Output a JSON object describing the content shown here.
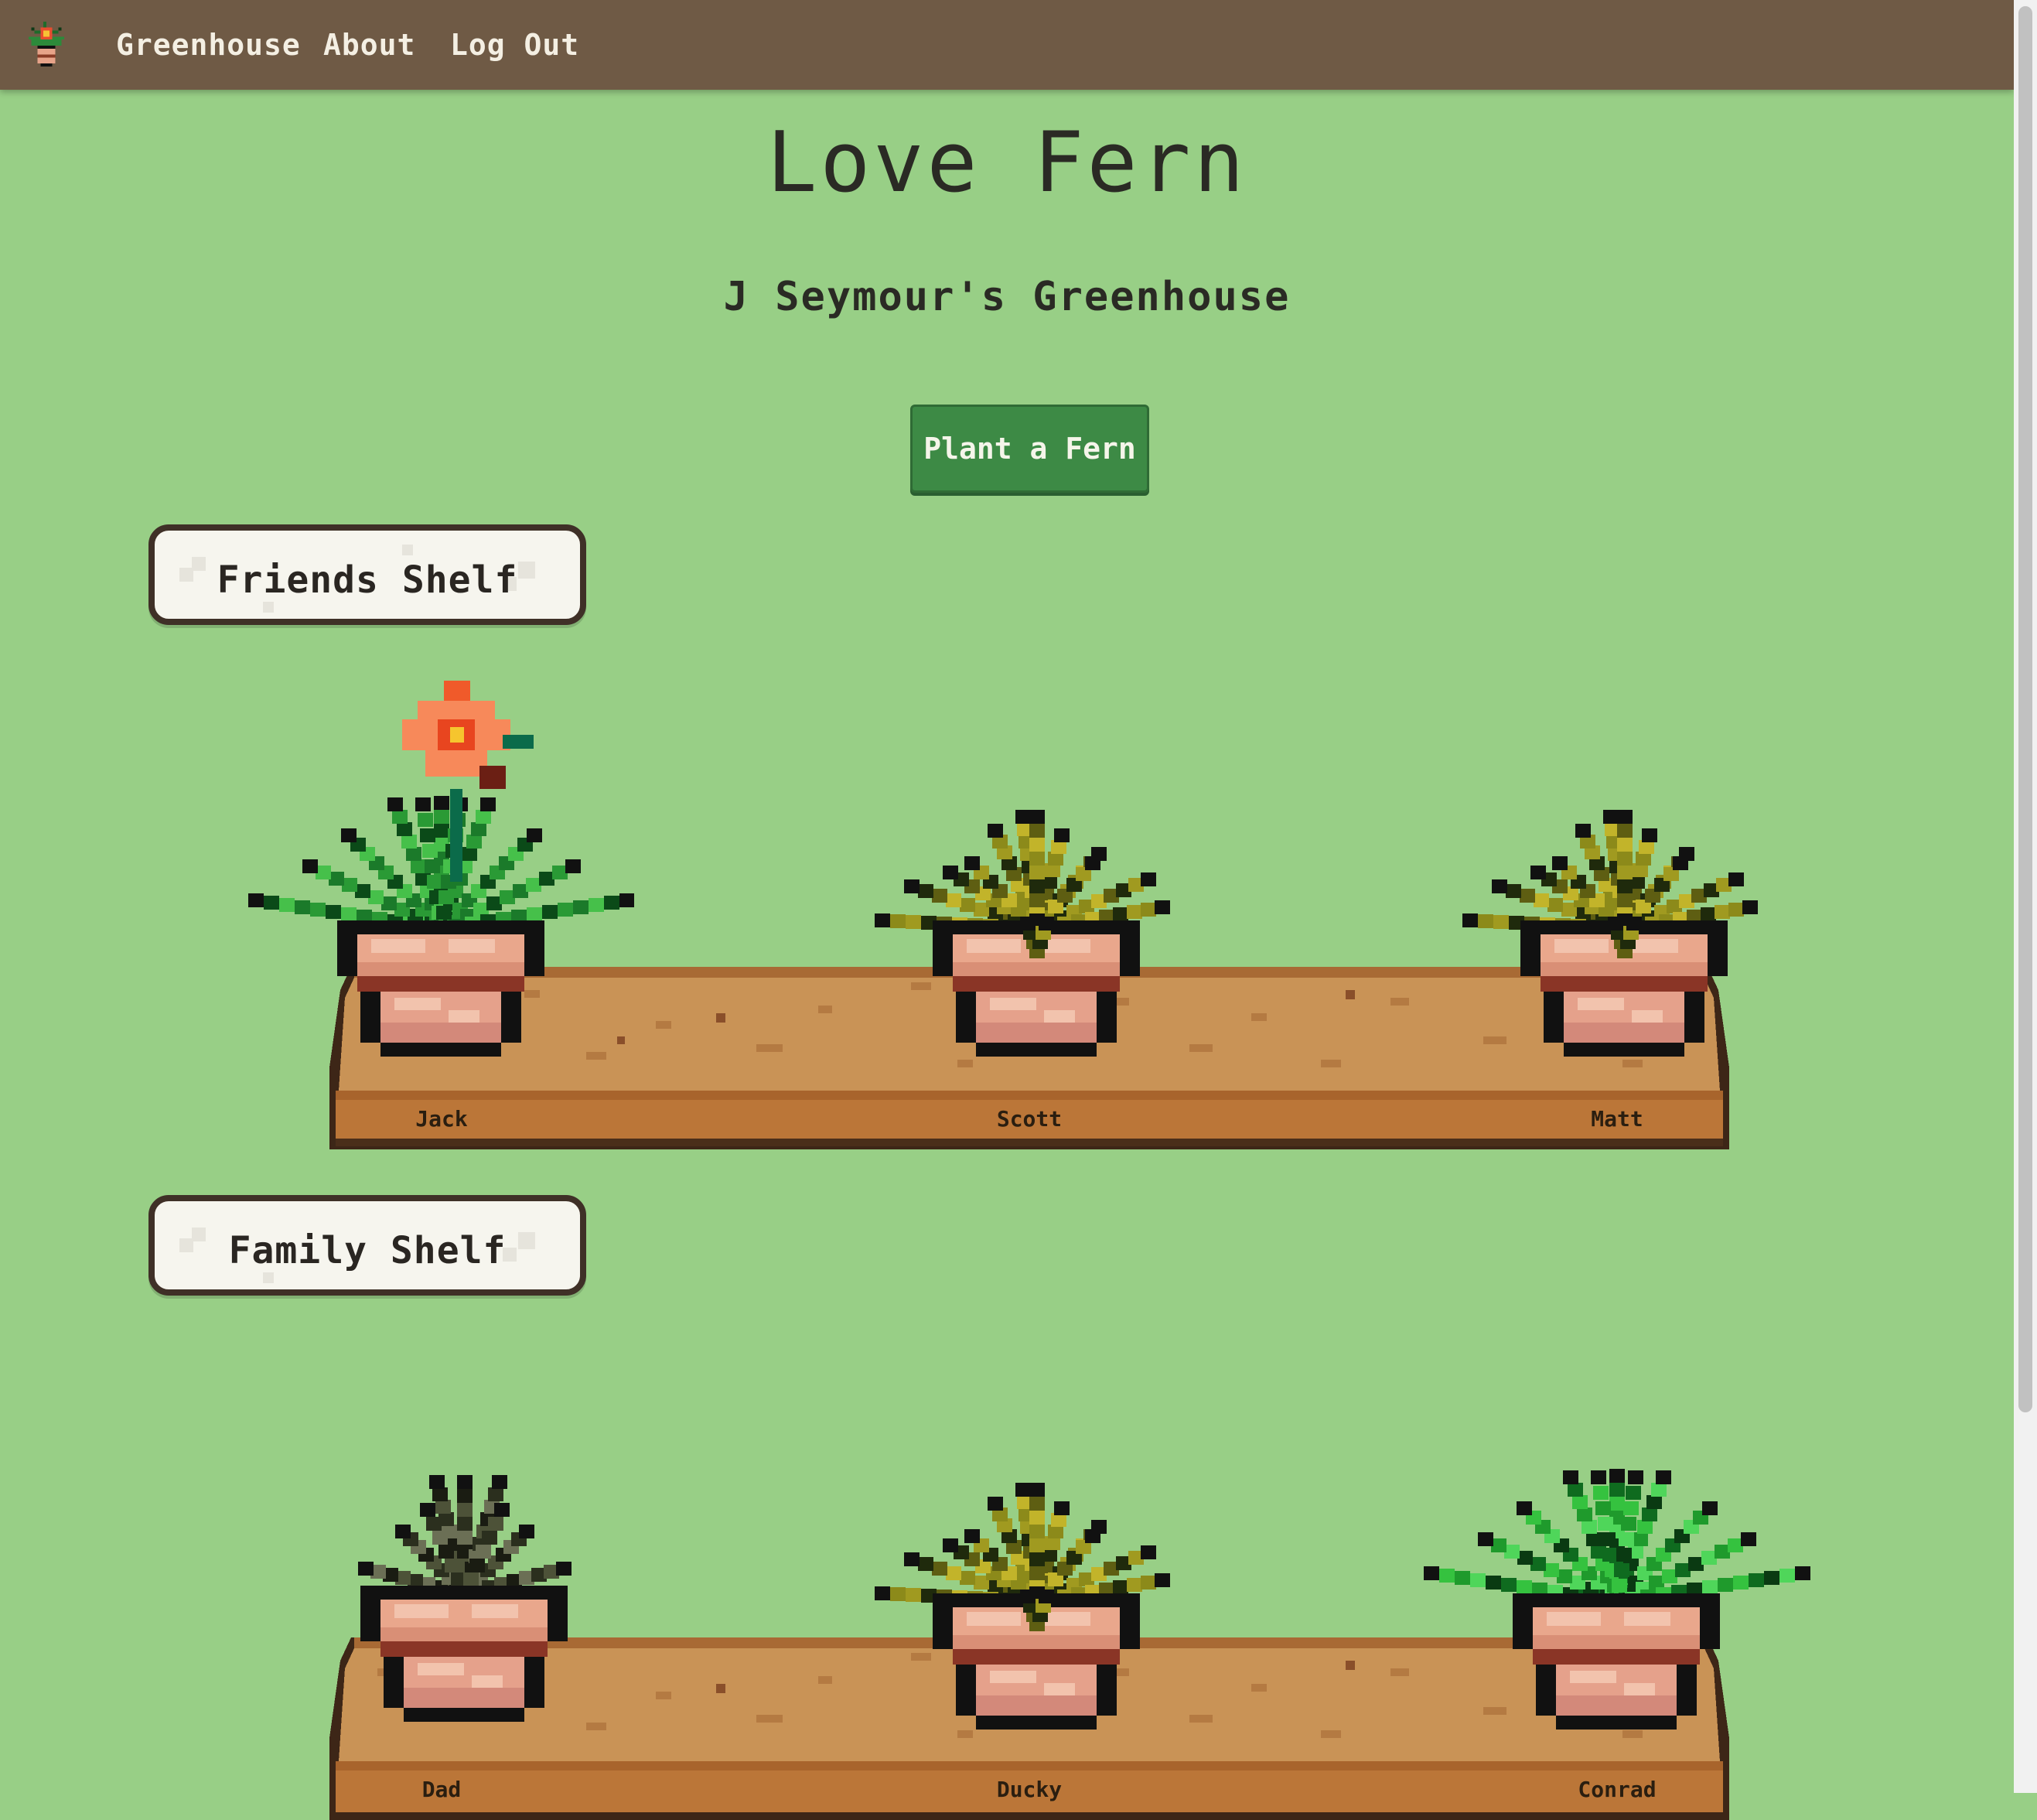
{
  "nav": {
    "logo_icon": "potted-plant-logo-icon",
    "links": [
      "Greenhouse",
      "About",
      "Log Out"
    ]
  },
  "header": {
    "title": "Love Fern",
    "subtitle": "J Seymour's Greenhouse"
  },
  "actions": {
    "plant_button": "Plant a Fern"
  },
  "colors": {
    "nav_bg": "#6f5a45",
    "page_bg": "#98cf86",
    "button_bg": "#3d8a45",
    "shelf_top": "#c99356",
    "shelf_front": "#bb7638"
  },
  "shelves": [
    {
      "label": "Friends Shelf",
      "plants": [
        {
          "name": "Jack",
          "type": "flowering-fern"
        },
        {
          "name": "Scott",
          "type": "yellow-fern"
        },
        {
          "name": "Matt",
          "type": "yellow-fern"
        }
      ]
    },
    {
      "label": "Family Shelf",
      "plants": [
        {
          "name": "Dad",
          "type": "dark-wilted-fern"
        },
        {
          "name": "Ducky",
          "type": "yellow-fern"
        },
        {
          "name": "Conrad",
          "type": "green-fern"
        }
      ]
    }
  ]
}
